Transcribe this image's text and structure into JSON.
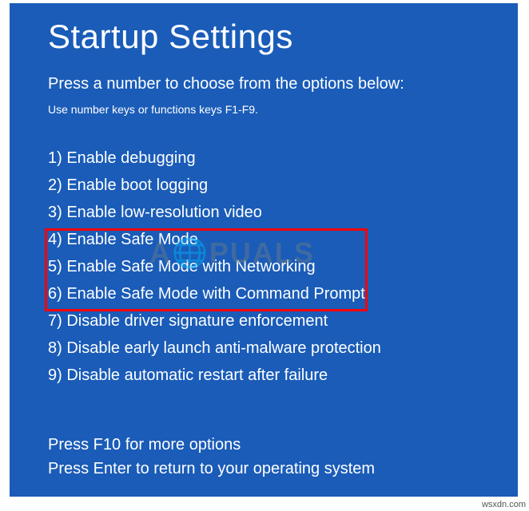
{
  "title": "Startup Settings",
  "subtitle": "Press a number to choose from the options below:",
  "hint": "Use number keys or functions keys F1-F9.",
  "options": [
    "1) Enable debugging",
    "2) Enable boot logging",
    "3) Enable low-resolution video",
    "4) Enable Safe Mode",
    "5) Enable Safe Mode with Networking",
    "6) Enable Safe Mode with Command Prompt",
    "7) Disable driver signature enforcement",
    "8) Disable early launch anti-malware protection",
    "9) Disable automatic restart after failure"
  ],
  "footer": {
    "line1": "Press F10 for more options",
    "line2": "Press Enter to return to your operating system"
  },
  "watermark": "A🌐PUALS",
  "attribution": "wsxdn.com"
}
